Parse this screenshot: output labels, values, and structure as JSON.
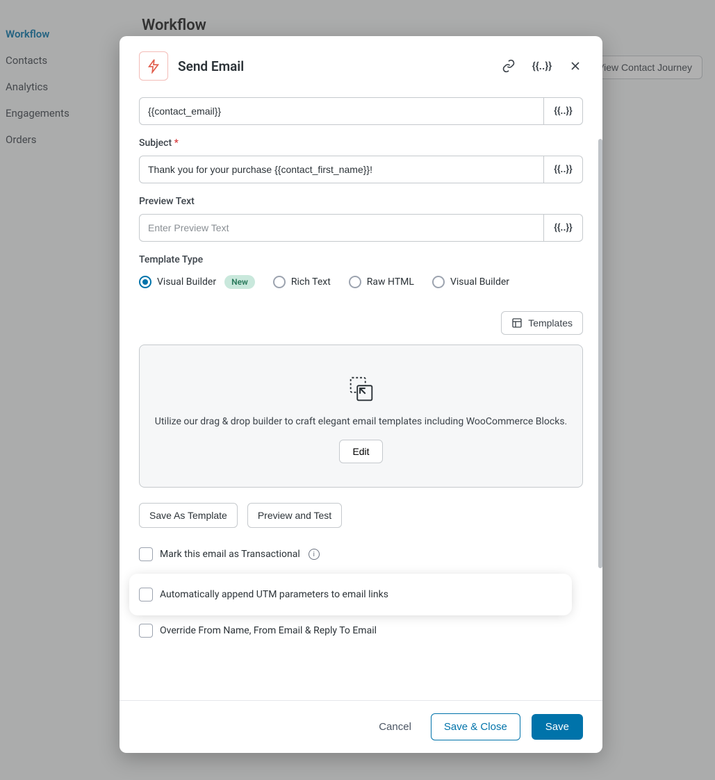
{
  "sidebar": {
    "items": [
      {
        "label": "Workflow",
        "active": true
      },
      {
        "label": "Contacts",
        "active": false
      },
      {
        "label": "Analytics",
        "active": false
      },
      {
        "label": "Engagements",
        "active": false
      },
      {
        "label": "Orders",
        "active": false
      }
    ]
  },
  "page": {
    "title": "Workflow",
    "journey_button": "View Contact Journey"
  },
  "modal": {
    "title": "Send Email",
    "merge_glyph": "{{..}}",
    "fields": {
      "to_value": "{{contact_email}}",
      "subject_label": "Subject",
      "subject_value": "Thank you for your purchase {{contact_first_name}}!",
      "preview_label": "Preview Text",
      "preview_placeholder": "Enter Preview Text",
      "preview_value": ""
    },
    "template_type": {
      "label": "Template Type",
      "options": [
        {
          "label": "Visual Builder",
          "checked": true,
          "badge": "New"
        },
        {
          "label": "Rich Text",
          "checked": false
        },
        {
          "label": "Raw HTML",
          "checked": false
        },
        {
          "label": "Visual Builder",
          "checked": false
        }
      ]
    },
    "templates_button": "Templates",
    "builder": {
      "description": "Utilize our drag & drop builder to craft elegant email templates including WooCommerce Blocks.",
      "edit_label": "Edit"
    },
    "actions": {
      "save_template": "Save As Template",
      "preview_test": "Preview and Test"
    },
    "checkboxes": {
      "transactional": "Mark this email as Transactional",
      "utm": "Automatically append UTM parameters to email links",
      "override": "Override From Name, From Email & Reply To Email"
    },
    "footer": {
      "cancel": "Cancel",
      "save_close": "Save & Close",
      "save": "Save"
    }
  }
}
